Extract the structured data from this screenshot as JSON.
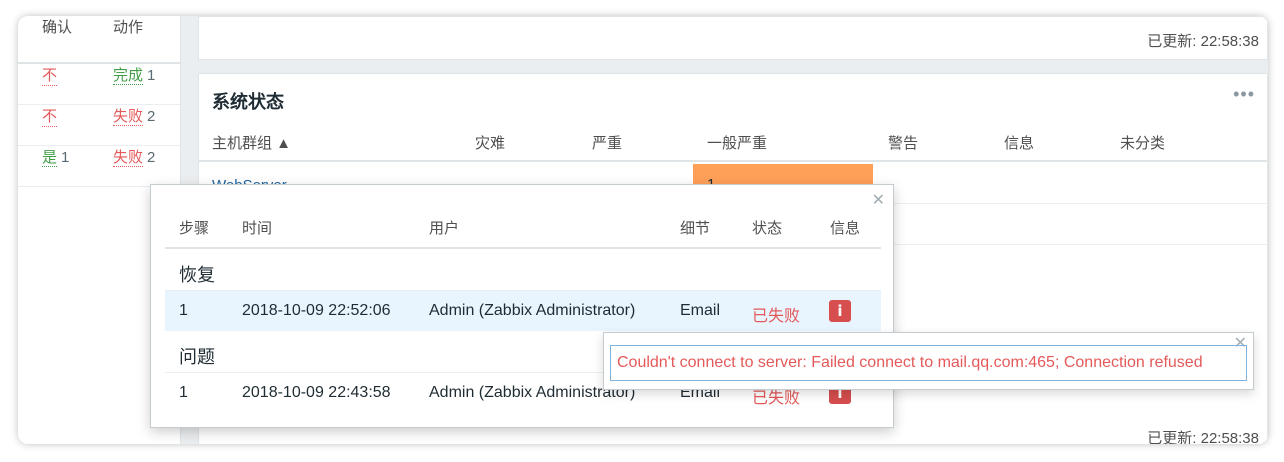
{
  "left_panel": {
    "headers": [
      "确认",
      "动作"
    ],
    "rows": [
      {
        "ack": "不",
        "ack_count": "",
        "action": "完成",
        "action_count": "1"
      },
      {
        "ack": "不",
        "ack_count": "",
        "action": "失败",
        "action_count": "2"
      },
      {
        "ack": "是",
        "ack_count": "1",
        "action": "失败",
        "action_count": "2"
      }
    ]
  },
  "top_widget": {
    "updated": "已更新: 22:58:38"
  },
  "system_status": {
    "title": "系统状态",
    "menu_icon": "ellipsis-icon",
    "columns": [
      "主机群组 ▲",
      "灾难",
      "严重",
      "一般严重",
      "警告",
      "信息",
      "未分类"
    ],
    "rows": [
      {
        "host_group": "WebServer",
        "average": "1"
      }
    ],
    "updated": "已更新: 22:58:38"
  },
  "popup": {
    "close_icon": "close-icon",
    "columns": [
      "步骤",
      "时间",
      "用户",
      "细节",
      "状态",
      "信息"
    ],
    "sections": [
      {
        "title": "恢复",
        "rows": [
          {
            "step": "1",
            "time": "2018-10-09 22:52:06",
            "user": "Admin (Zabbix Administrator)",
            "details": "Email",
            "status": "已失败",
            "info": "i"
          }
        ]
      },
      {
        "title": "问题",
        "rows": [
          {
            "step": "1",
            "time": "2018-10-09 22:43:58",
            "user": "Admin (Zabbix Administrator)",
            "details": "Email",
            "status": "已失败",
            "info": "i"
          }
        ]
      }
    ]
  },
  "tooltip": {
    "message": "Couldn't connect to server: Failed connect to mail.qq.com:465; Connection refused",
    "close_icon": "close-icon"
  },
  "colors": {
    "fail": "#e45959",
    "ok": "#429e47",
    "average_severity": "#ffa059",
    "link": "#1f65a6"
  }
}
